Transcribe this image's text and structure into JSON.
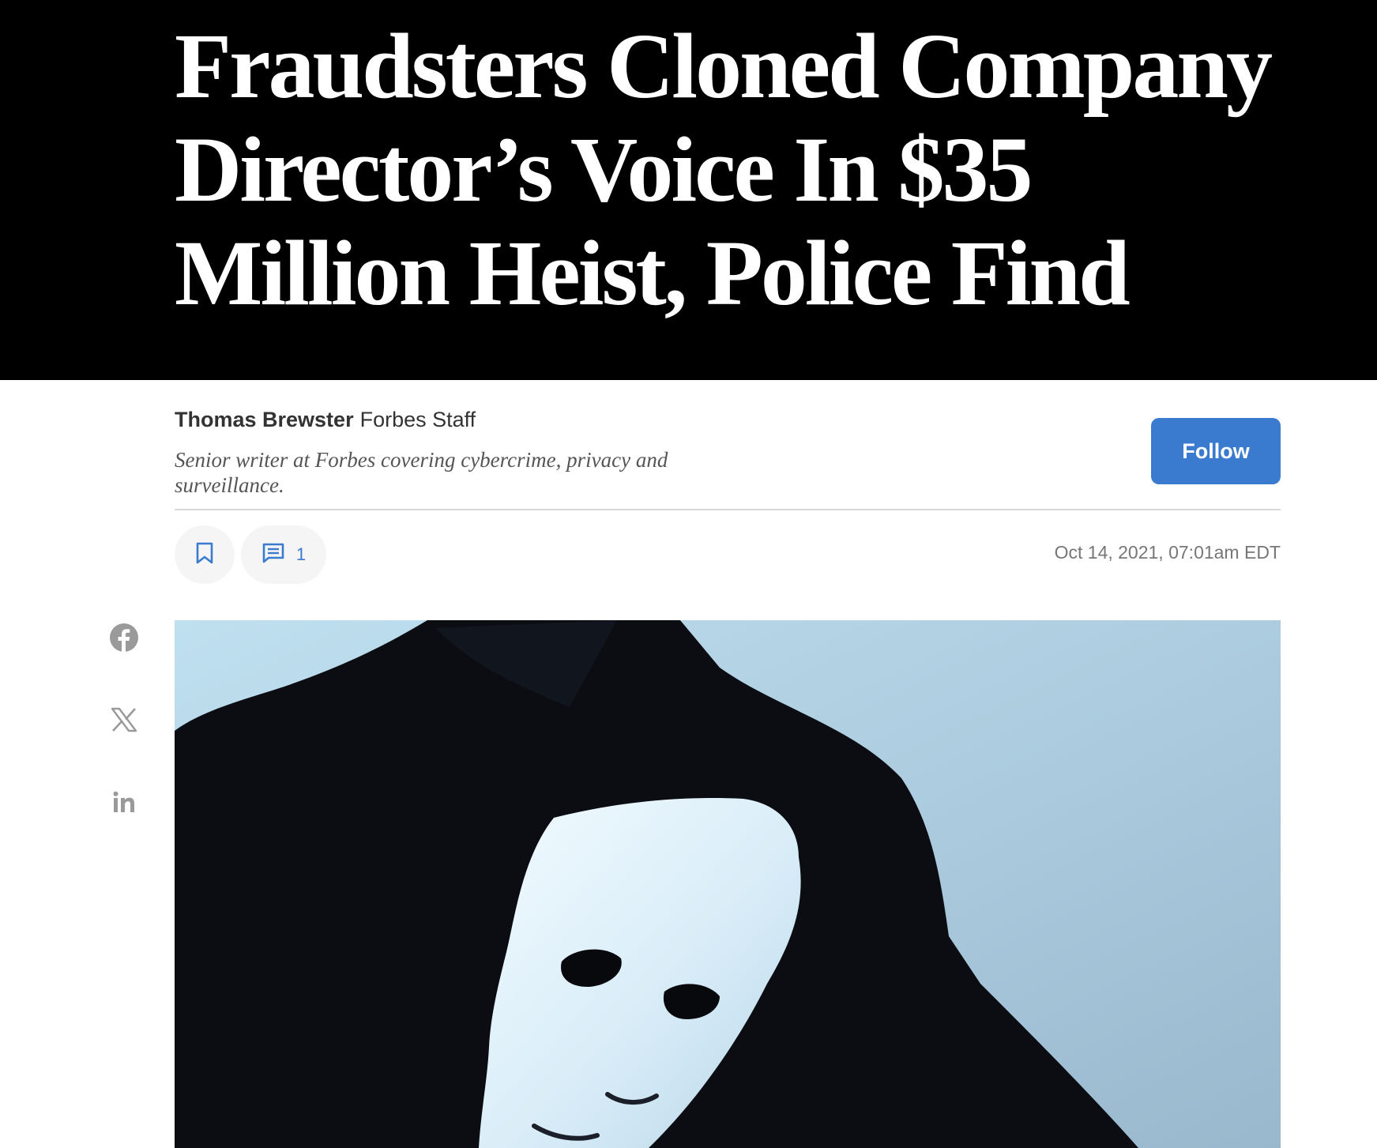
{
  "article": {
    "headline": "Fraudsters Cloned Company Director’s Voice In $35 Million Heist, Police Find",
    "date": "Oct 14, 2021, 07:01am EDT",
    "image_alt": "Person in a dark suit holding a white mask behind their back"
  },
  "author": {
    "name": "Thomas Brewster",
    "role": "Forbes Staff",
    "bio": "Senior writer at Forbes covering cybercrime, privacy and surveillance.",
    "follow_label": "Follow"
  },
  "actions": {
    "bookmark_icon": "bookmark-icon",
    "comment_icon": "comment-icon",
    "comment_count": "1"
  },
  "share": {
    "icons": [
      "facebook-icon",
      "x-icon",
      "linkedin-icon"
    ]
  },
  "colors": {
    "header_bg": "#000000",
    "headline_text": "#ffffff",
    "accent_blue": "#3a7bd0",
    "muted_text": "#777777",
    "share_icon": "#999999"
  }
}
